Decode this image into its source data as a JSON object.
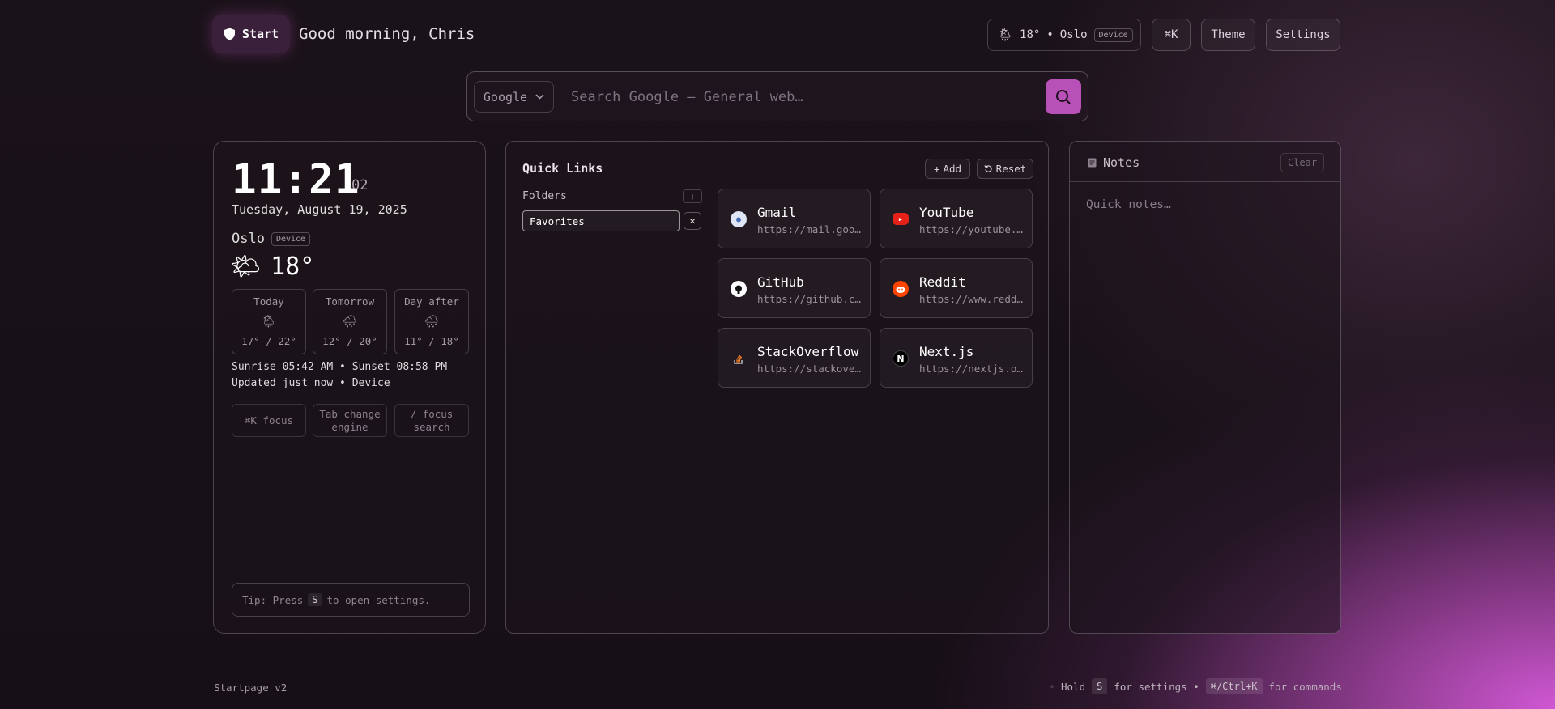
{
  "header": {
    "brand_label": "Start",
    "greeting": "Good morning, Chris",
    "weather_chip": {
      "temp": "18°",
      "separator": "•",
      "city": "Oslo",
      "source_badge": "Device"
    },
    "cmdk_label": "⌘K",
    "theme_label": "Theme",
    "settings_label": "Settings"
  },
  "search": {
    "engine": "Google",
    "placeholder": "Search Google — General web…"
  },
  "clock": {
    "time": "11:21",
    "seconds": "02",
    "date": "Tuesday, August 19, 2025",
    "city": "Oslo",
    "source_badge": "Device",
    "current_temp": "18°",
    "forecast": [
      {
        "day": "Today",
        "range": "17° / 22°"
      },
      {
        "day": "Tomorrow",
        "range": "12° / 20°"
      },
      {
        "day": "Day after",
        "range": "11° / 18°"
      }
    ],
    "sun_line": "Sunrise 05:42 AM • Sunset 08:58 PM",
    "updated_line": "Updated just now • Device",
    "hints": [
      "⌘K focus",
      "Tab change engine",
      "/ focus search"
    ],
    "tip": {
      "prefix": "Tip: Press",
      "key": "S",
      "suffix": "to open settings."
    }
  },
  "quick_links": {
    "title": "Quick Links",
    "add_label": "Add",
    "reset_label": "Reset",
    "folders_label": "Folders",
    "add_folder_label": "+",
    "folder_value": "Favorites",
    "links": [
      {
        "name": "Gmail",
        "url": "https://mail.google.com"
      },
      {
        "name": "YouTube",
        "url": "https://youtube.com"
      },
      {
        "name": "GitHub",
        "url": "https://github.com"
      },
      {
        "name": "Reddit",
        "url": "https://www.reddit.com"
      },
      {
        "name": "StackOverflow",
        "url": "https://stackoverflow.com"
      },
      {
        "name": "Next.js",
        "url": "https://nextjs.org"
      }
    ]
  },
  "notes": {
    "title": "Notes",
    "clear_label": "Clear",
    "placeholder": "Quick notes…"
  },
  "footer": {
    "version": "Startpage v2",
    "hold": "Hold",
    "key_s": "S",
    "for_settings": "for settings •",
    "key_cmd": "⌘/Ctrl+K",
    "for_commands": "for commands"
  },
  "colors": {
    "accent": "#b851b7",
    "gradient_corner": "#d058d4"
  },
  "icons": {
    "brand": "shield-icon",
    "weather": "sun-behind-rain-cloud-icon",
    "search": "search-icon",
    "notes": "document-icon"
  }
}
